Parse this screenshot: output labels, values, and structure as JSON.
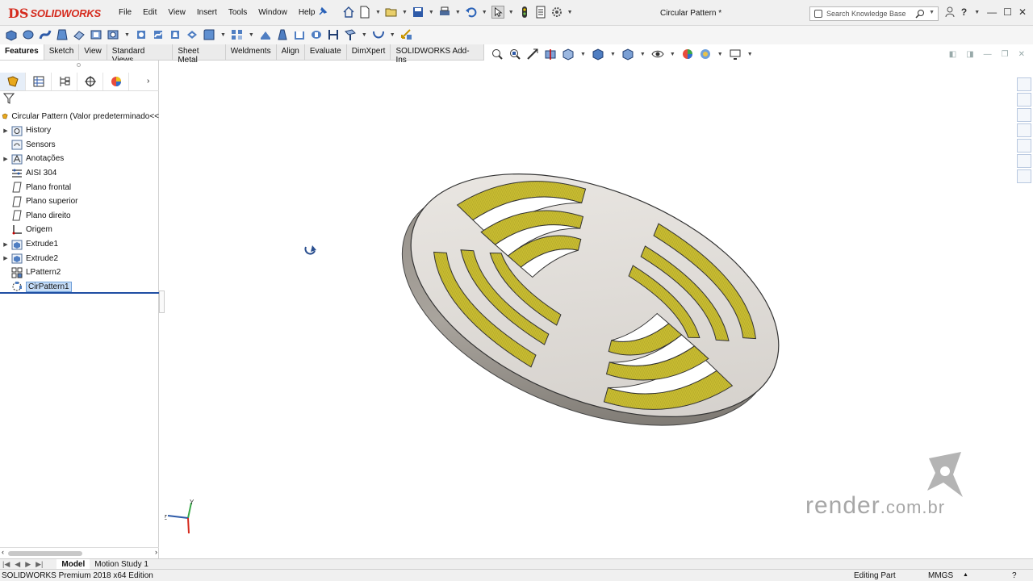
{
  "app": {
    "brand_ds": "DS",
    "brand_name": "SOLIDWORKS",
    "document_title": "Circular Pattern *"
  },
  "menu": [
    "File",
    "Edit",
    "View",
    "Insert",
    "Tools",
    "Window",
    "Help"
  ],
  "search": {
    "placeholder": "Search Knowledge Base"
  },
  "command_tabs": [
    "Features",
    "Sketch",
    "View",
    "Standard Views",
    "Sheet Metal",
    "Weldments",
    "Align",
    "Evaluate",
    "DimXpert",
    "SOLIDWORKS Add-Ins"
  ],
  "active_command_tab": "Features",
  "feature_tree": {
    "root_label": "Circular Pattern  (Valor predeterminado<<",
    "items": [
      {
        "label": "History",
        "icon": "history-folder-icon",
        "expandable": true
      },
      {
        "label": "Sensors",
        "icon": "sensors-icon",
        "expandable": false
      },
      {
        "label": "Anotações",
        "icon": "annotations-icon",
        "expandable": true
      },
      {
        "label": "AISI 304",
        "icon": "material-icon",
        "expandable": false
      },
      {
        "label": "Plano frontal",
        "icon": "plane-icon",
        "expandable": false
      },
      {
        "label": "Plano superior",
        "icon": "plane-icon",
        "expandable": false
      },
      {
        "label": "Plano direito",
        "icon": "plane-icon",
        "expandable": false
      },
      {
        "label": "Origem",
        "icon": "origin-icon",
        "expandable": false
      },
      {
        "label": "Extrude1",
        "icon": "extrude-icon",
        "expandable": true
      },
      {
        "label": "Extrude2",
        "icon": "extrude-icon",
        "expandable": true
      },
      {
        "label": "LPattern2",
        "icon": "linear-pattern-icon",
        "expandable": false
      },
      {
        "label": "CirPattern1",
        "icon": "circular-pattern-icon",
        "expandable": false,
        "selected": true
      }
    ]
  },
  "bottom_tabs": [
    "Model",
    "Motion Study 1"
  ],
  "active_bottom_tab": "Model",
  "status": {
    "product": "SOLIDWORKS Premium 2018 x64 Edition",
    "mode": "Editing Part",
    "units": "MMGS",
    "help": "?"
  },
  "watermark": {
    "text": "render",
    "suffix": ".com.br"
  },
  "colors": {
    "brand_red": "#d52b1e",
    "slot_wall_yellow": "#c8bd2e",
    "part_face": "#d9d6d2",
    "selection_blue": "#1f4ea3"
  }
}
